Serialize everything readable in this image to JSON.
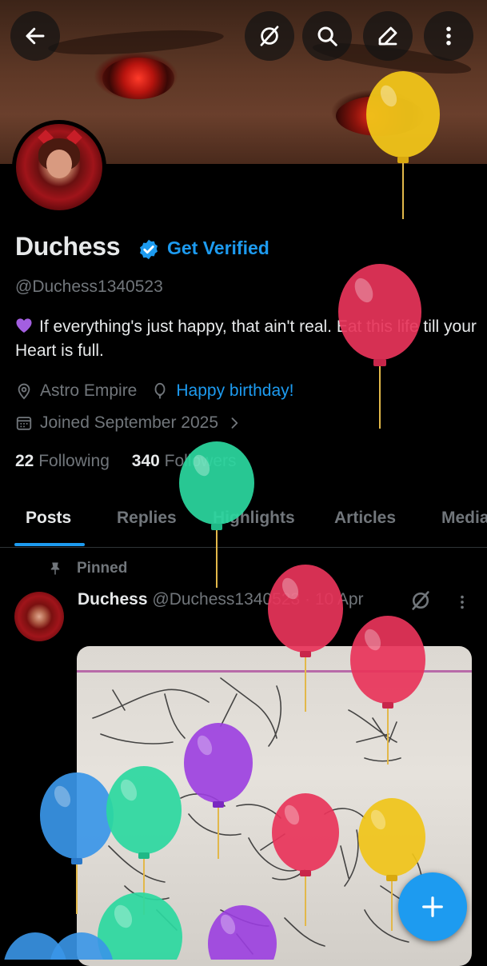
{
  "header": {
    "back_icon": "arrow-left-icon",
    "grok_icon": "grok-icon",
    "search_icon": "search-icon",
    "edit_icon": "pencil-icon",
    "more_icon": "more-vertical-icon"
  },
  "profile": {
    "name": "Duchess",
    "get_verified": "Get Verified",
    "handle": "@Duchess1340523",
    "bio": "If everything's just happy, that ain't real. Eat this life till your Heart is full.",
    "location": "Astro Empire",
    "birthday": "Happy birthday!",
    "joined": "Joined September 2025",
    "following_count": "22",
    "following_label": "Following",
    "followers_count": "340",
    "followers_label": "Followers"
  },
  "tabs": [
    {
      "label": "Posts",
      "active": true
    },
    {
      "label": "Replies"
    },
    {
      "label": "Highlights"
    },
    {
      "label": "Articles"
    },
    {
      "label": "Media"
    }
  ],
  "post": {
    "pinned_label": "Pinned",
    "author": "Duchess",
    "handle_date": "@Duchess1340523 · 10 Apr"
  },
  "colors": {
    "accent": "#1d9bf0",
    "text": "#e7e9ea",
    "muted": "#71767b",
    "background": "#000000"
  }
}
